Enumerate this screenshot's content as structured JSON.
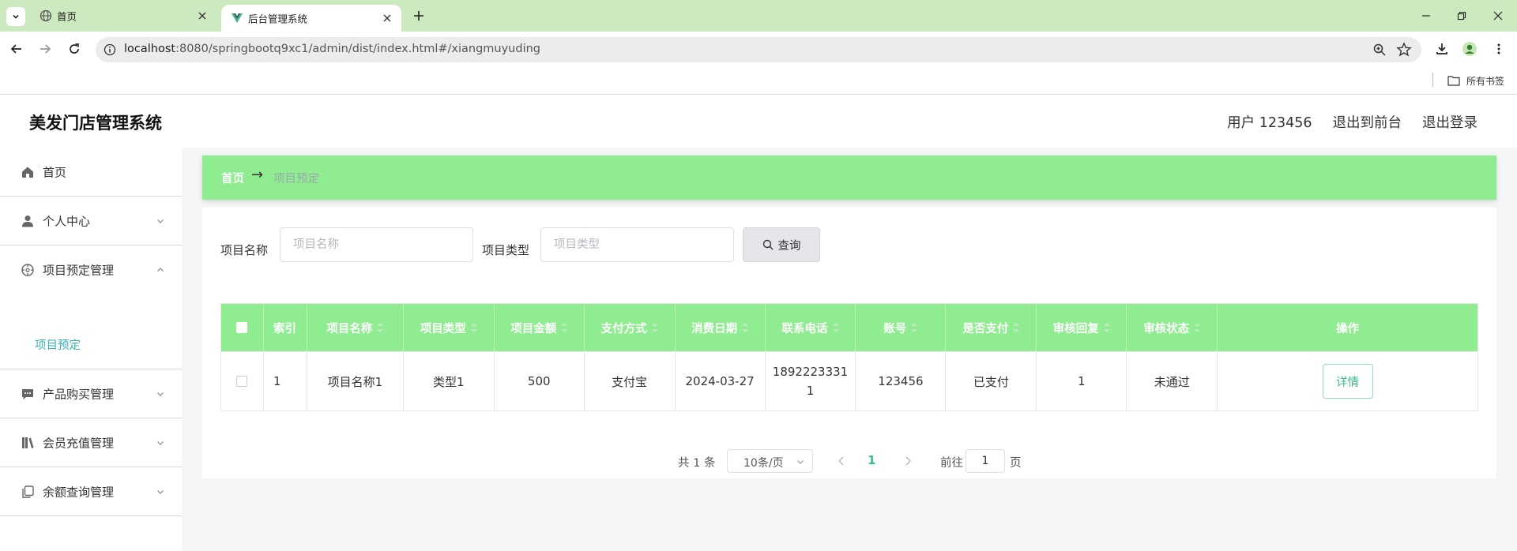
{
  "browser": {
    "tabs": [
      {
        "title": "首页",
        "active": false
      },
      {
        "title": "后台管理系统",
        "active": true
      }
    ],
    "url_host": "localhost",
    "url_rest": ":8080/springbootq9xc1/admin/dist/index.html#/xiangmuyuding",
    "bookmarks_folder": "所有书签"
  },
  "app": {
    "brand": "美发门店管理系统",
    "top_links": {
      "user": "用户 123456",
      "to_front": "退出到前台",
      "logout": "退出登录"
    },
    "sidebar": [
      {
        "label": "首页",
        "icon": "home-icon"
      },
      {
        "label": "个人中心",
        "icon": "user-icon"
      },
      {
        "label": "项目预定管理",
        "icon": "target-icon",
        "expanded": true,
        "children": [
          {
            "label": "项目预定"
          }
        ]
      },
      {
        "label": "产品购买管理",
        "icon": "chat-icon"
      },
      {
        "label": "会员充值管理",
        "icon": "books-icon"
      },
      {
        "label": "余额查询管理",
        "icon": "copy-icon"
      }
    ],
    "breadcrumb": {
      "home": "首页",
      "arrow": "→",
      "current": "项目预定"
    },
    "filters": {
      "name_label": "项目名称",
      "name_placeholder": "项目名称",
      "type_label": "项目类型",
      "type_placeholder": "项目类型",
      "search_button": "查询"
    },
    "table": {
      "headers": [
        "索引",
        "项目名称",
        "项目类型",
        "项目金额",
        "支付方式",
        "消费日期",
        "联系电话",
        "账号",
        "是否支付",
        "审核回复",
        "审核状态",
        "操作"
      ],
      "rows": [
        {
          "index": "1",
          "name": "项目名称1",
          "type": "类型1",
          "amount": "500",
          "pay_method": "支付宝",
          "date": "2024-03-27",
          "phone_line1": "1892223331",
          "phone_line2": "1",
          "account": "123456",
          "paid": "已支付",
          "reply": "1",
          "status": "未通过",
          "action": "详情"
        }
      ]
    },
    "pagination": {
      "total": "共 1 条",
      "page_size": "10条/页",
      "current_page": "1",
      "goto_label": "前往",
      "goto_value": "1",
      "page_suffix": "页"
    },
    "colors": {
      "accent_green": "#90ec90",
      "sidebar_active": "#3ab0b6",
      "link_green": "#3bbd8a"
    }
  }
}
